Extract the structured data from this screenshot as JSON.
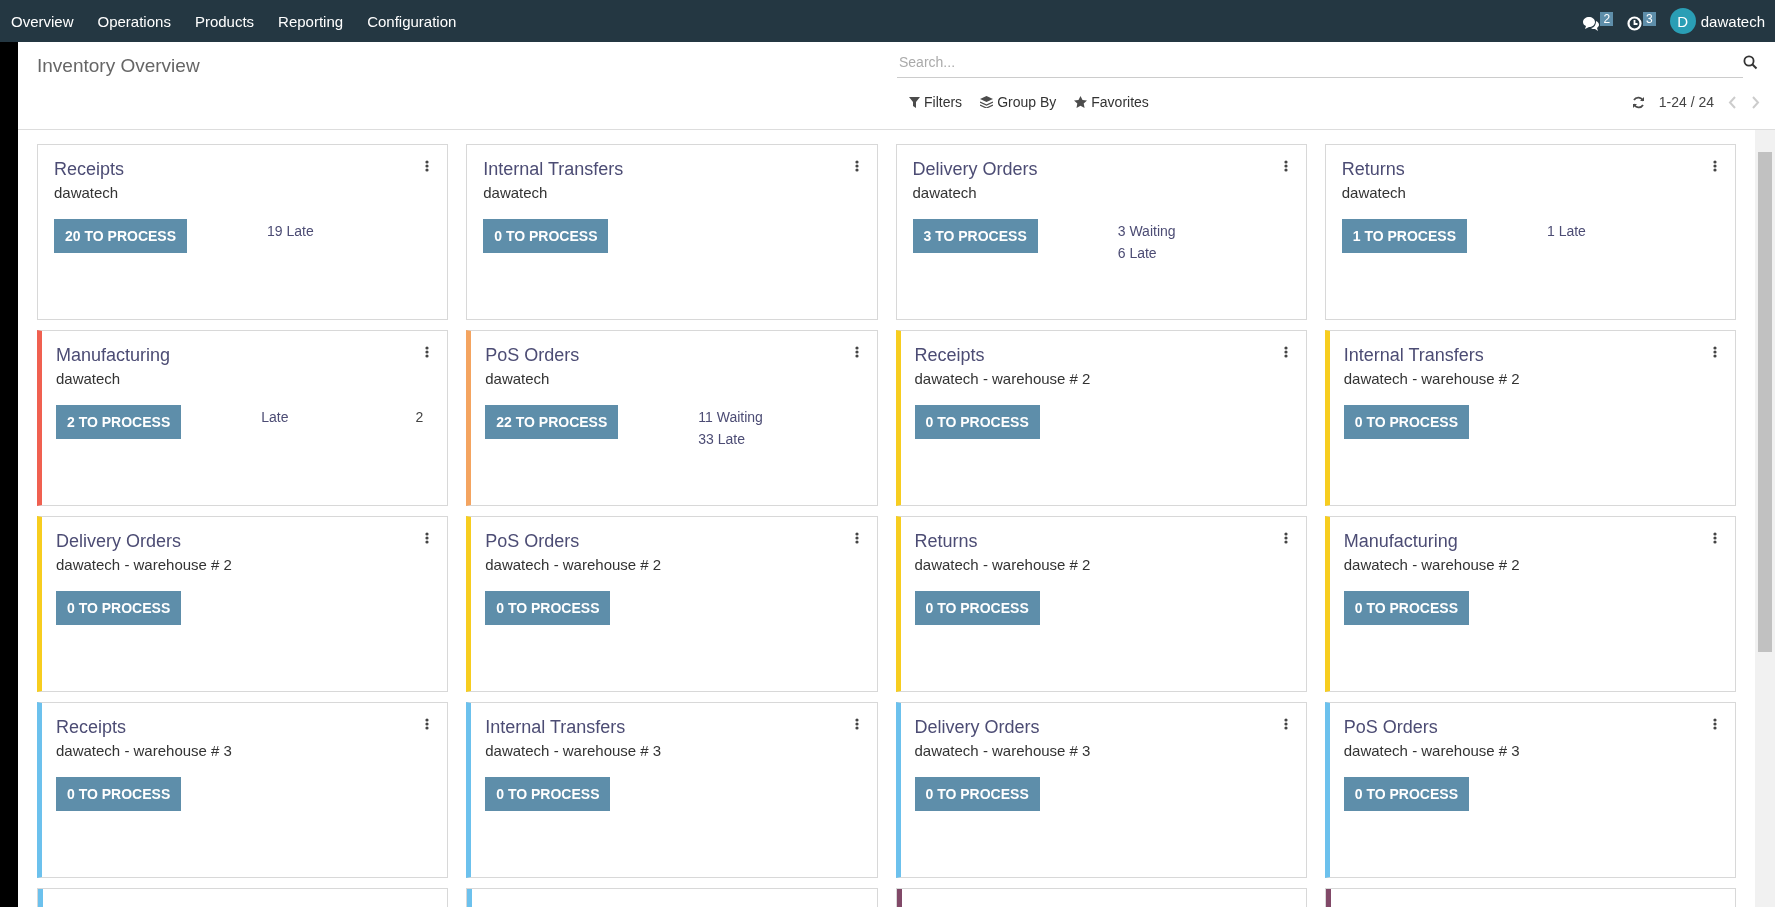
{
  "navbar": {
    "menu": [
      {
        "label": "Overview"
      },
      {
        "label": "Operations"
      },
      {
        "label": "Products"
      },
      {
        "label": "Reporting"
      },
      {
        "label": "Configuration"
      }
    ],
    "messages_badge": "2",
    "activities_badge": "3",
    "user": {
      "initial": "D",
      "name": "dawatech"
    }
  },
  "control_panel": {
    "title": "Inventory Overview",
    "search": {
      "placeholder": "Search..."
    },
    "filters": [
      {
        "kind": "filter",
        "label": "Filters"
      },
      {
        "kind": "group",
        "label": "Group By"
      },
      {
        "kind": "favorite",
        "label": "Favorites"
      }
    ],
    "pager": "1-24 / 24"
  },
  "cards": [
    {
      "title": "Receipts",
      "subtitle": "dawatech",
      "button": "20 TO PROCESS",
      "stats": [
        {
          "label": "19 Late"
        }
      ]
    },
    {
      "title": "Internal Transfers",
      "subtitle": "dawatech",
      "button": "0 TO PROCESS"
    },
    {
      "title": "Delivery Orders",
      "subtitle": "dawatech",
      "button": "3 TO PROCESS",
      "stats": [
        {
          "label": "3 Waiting"
        },
        {
          "label": "6 Late"
        }
      ]
    },
    {
      "title": "Returns",
      "subtitle": "dawatech",
      "button": "1 TO PROCESS",
      "stats": [
        {
          "label": "1 Late"
        }
      ]
    },
    {
      "title": "Manufacturing",
      "subtitle": "dawatech",
      "button": "2 TO PROCESS",
      "color": "#f06050",
      "stats": [
        {
          "label": "Late",
          "count": "2"
        }
      ]
    },
    {
      "title": "PoS Orders",
      "subtitle": "dawatech",
      "button": "22 TO PROCESS",
      "color": "#f4a460",
      "stats": [
        {
          "label": "11 Waiting"
        },
        {
          "label": "33 Late"
        }
      ]
    },
    {
      "title": "Receipts",
      "subtitle": "dawatech - warehouse # 2",
      "button": "0 TO PROCESS",
      "color": "#f7cd1f"
    },
    {
      "title": "Internal Transfers",
      "subtitle": "dawatech - warehouse # 2",
      "button": "0 TO PROCESS",
      "color": "#f7cd1f"
    },
    {
      "title": "Delivery Orders",
      "subtitle": "dawatech - warehouse # 2",
      "button": "0 TO PROCESS",
      "color": "#f7cd1f"
    },
    {
      "title": "PoS Orders",
      "subtitle": "dawatech - warehouse # 2",
      "button": "0 TO PROCESS",
      "color": "#f7cd1f"
    },
    {
      "title": "Returns",
      "subtitle": "dawatech - warehouse # 2",
      "button": "0 TO PROCESS",
      "color": "#f7cd1f"
    },
    {
      "title": "Manufacturing",
      "subtitle": "dawatech - warehouse # 2",
      "button": "0 TO PROCESS",
      "color": "#f7cd1f"
    },
    {
      "title": "Receipts",
      "subtitle": "dawatech - warehouse # 3",
      "button": "0 TO PROCESS",
      "color": "#6cc1ed"
    },
    {
      "title": "Internal Transfers",
      "subtitle": "dawatech - warehouse # 3",
      "button": "0 TO PROCESS",
      "color": "#6cc1ed"
    },
    {
      "title": "Delivery Orders",
      "subtitle": "dawatech - warehouse # 3",
      "button": "0 TO PROCESS",
      "color": "#6cc1ed"
    },
    {
      "title": "PoS Orders",
      "subtitle": "dawatech - warehouse # 3",
      "button": "0 TO PROCESS",
      "color": "#6cc1ed"
    }
  ],
  "partial_cards": [
    {
      "color": "#6cc1ed"
    },
    {
      "color": "#6cc1ed"
    },
    {
      "color": "#814968"
    },
    {
      "color": "#814968"
    }
  ]
}
